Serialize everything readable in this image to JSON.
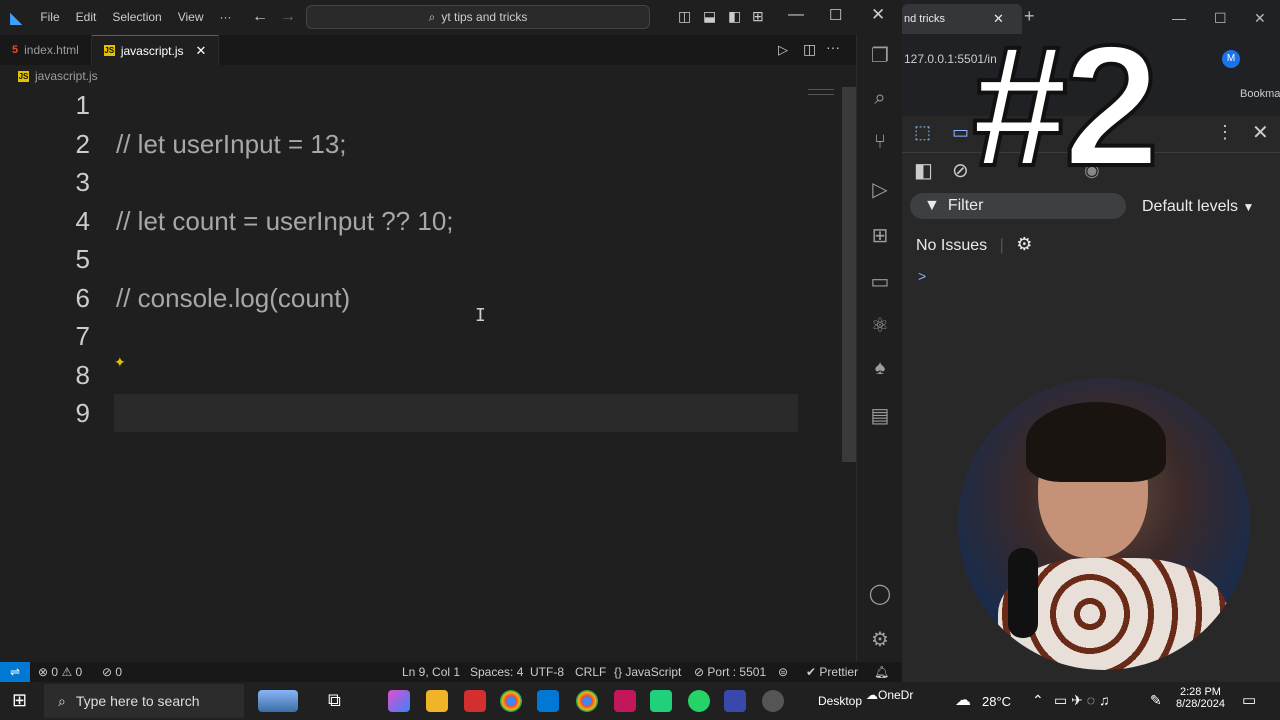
{
  "vscode": {
    "menu": [
      "File",
      "Edit",
      "Selection",
      "View",
      "···"
    ],
    "search_text": "yt tips and tricks",
    "tabs": [
      {
        "label": "index.html",
        "active": false
      },
      {
        "label": "javascript.js",
        "active": true
      }
    ],
    "breadcrumb": "javascript.js",
    "lines": [
      {
        "num": "1",
        "text": ""
      },
      {
        "num": "2",
        "text": "// let userInput = 13;"
      },
      {
        "num": "3",
        "text": ""
      },
      {
        "num": "4",
        "text": "// let count = userInput ?? 10;"
      },
      {
        "num": "5",
        "text": ""
      },
      {
        "num": "6",
        "text": "// console.log(count)"
      },
      {
        "num": "7",
        "text": ""
      },
      {
        "num": "8",
        "text": ""
      },
      {
        "num": "9",
        "text": ""
      }
    ],
    "status": {
      "errors": "0",
      "warnings": "0",
      "ports": "0",
      "position": "Ln 9, Col 1",
      "spaces": "Spaces: 4",
      "encoding": "UTF-8",
      "eol": "CRLF",
      "language": "JavaScript",
      "port": "Port : 5501",
      "prettier": "Prettier"
    }
  },
  "browser": {
    "tab_title": "nd tricks",
    "address": "127.0.0.1:5501/in",
    "avatar_letter": "M",
    "bookmarks": "Bookmarks",
    "filter_label": "Filter",
    "levels_label": "Default levels",
    "no_issues": "No Issues",
    "prompt": ">"
  },
  "overlay_title": "#2",
  "taskbar": {
    "search_placeholder": "Type here to search",
    "desktop_label": "Desktop",
    "onedrive_label": "OneDr",
    "temperature": "28°C",
    "time": "2:28 PM",
    "date": "8/28/2024"
  },
  "colors": {
    "accent": "#0078d4",
    "editor_bg": "#1f1f1f",
    "status_bg": "#181818"
  }
}
